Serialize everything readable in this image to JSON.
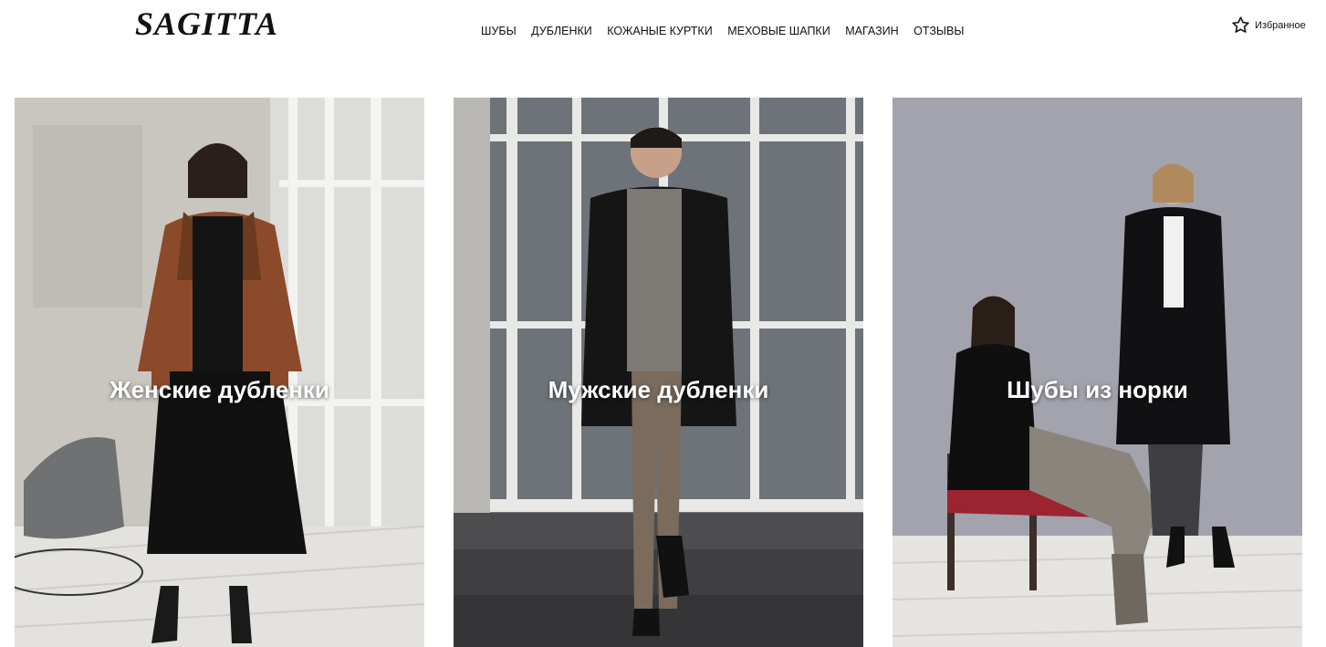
{
  "brand": {
    "logo": "SAGITTA"
  },
  "nav": {
    "items": [
      {
        "label": "ШУБЫ"
      },
      {
        "label": "ДУБЛЕНКИ"
      },
      {
        "label": "КОЖАНЫЕ КУРТКИ"
      },
      {
        "label": "МЕХОВЫЕ ШАПКИ"
      },
      {
        "label": "МАГАЗИН"
      },
      {
        "label": "ОТЗЫВЫ"
      }
    ]
  },
  "favorites": {
    "label": "Избранное",
    "icon": "star-outline-icon"
  },
  "categories": [
    {
      "title": "Женские дубленки"
    },
    {
      "title": "Мужские дубленки"
    },
    {
      "title": "Шубы из норки"
    }
  ]
}
